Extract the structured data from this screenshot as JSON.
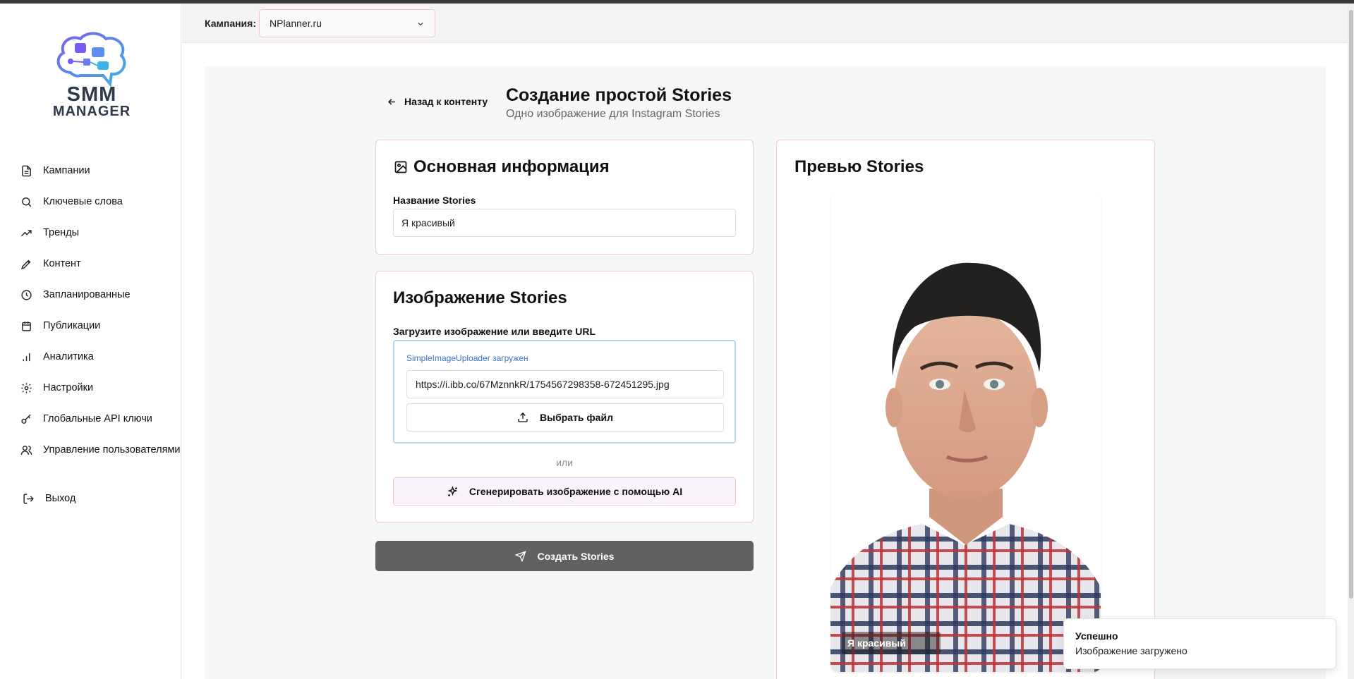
{
  "sidebar": {
    "logo": {
      "line1": "SMM",
      "line2": "MANAGER"
    },
    "items": [
      {
        "label": "Кампании",
        "icon": "document-icon"
      },
      {
        "label": "Ключевые слова",
        "icon": "search-icon"
      },
      {
        "label": "Тренды",
        "icon": "trending-icon"
      },
      {
        "label": "Контент",
        "icon": "pen-icon"
      },
      {
        "label": "Запланированные",
        "icon": "clock-icon"
      },
      {
        "label": "Публикации",
        "icon": "calendar-icon"
      },
      {
        "label": "Аналитика",
        "icon": "bar-chart-icon"
      },
      {
        "label": "Настройки",
        "icon": "gear-icon"
      },
      {
        "label": "Глобальные API ключи",
        "icon": "key-icon"
      },
      {
        "label": "Управление пользователями",
        "icon": "users-icon"
      }
    ],
    "exit": {
      "label": "Выход",
      "icon": "logout-icon"
    }
  },
  "header": {
    "campaign_label": "Кампания:",
    "campaign_value": "NPlanner.ru"
  },
  "page": {
    "back_label": "Назад к контенту",
    "title": "Создание простой Stories",
    "subtitle": "Одно изображение для Instagram Stories"
  },
  "basic_info": {
    "title": "Основная информация",
    "name_label": "Название Stories",
    "name_value": "Я красивый"
  },
  "image_card": {
    "title": "Изображение Stories",
    "upload_label": "Загрузите изображение или введите URL",
    "uploader_note": "SimpleImageUploader загружен",
    "url_value": "https://i.ibb.co/67MznnkR/1754567298358-672451295.jpg",
    "file_button": "Выбрать файл",
    "or_text": "или",
    "ai_button": "Сгенерировать изображение с помощью AI"
  },
  "create_button": "Создать Stories",
  "preview": {
    "title": "Превью Stories",
    "caption": "Я красивый"
  },
  "toast": {
    "title": "Успешно",
    "message": "Изображение загружено"
  },
  "colors": {
    "accent_border": "#f3c9d4",
    "uploader_border": "#b9d6f3",
    "create_button_bg": "#616161",
    "link_blue": "#3b6fd1"
  }
}
